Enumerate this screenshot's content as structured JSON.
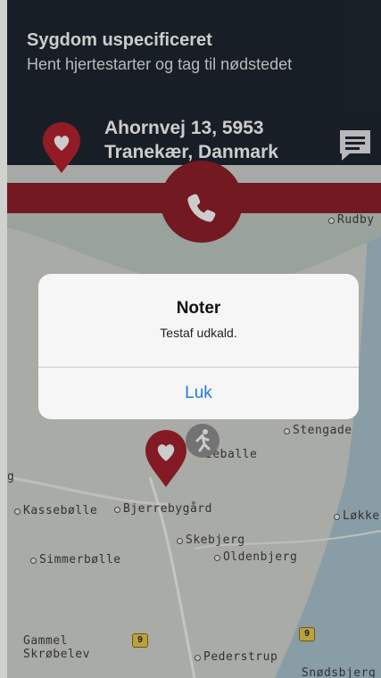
{
  "banner": {
    "title": "Sygdom uspecificeret",
    "subtitle": "Hent hjertestarter og tag til nødstedet",
    "address": "Ahornvej 13, 5953 Tranekær, Danmark",
    "icons": {
      "location": "heart-location-pin-icon",
      "chat": "chat-icon",
      "call": "phone-icon"
    }
  },
  "colors": {
    "banner": "#19212b",
    "accent_red": "#8c1a24",
    "alert_button": "#1f7ae0"
  },
  "alert": {
    "title": "Noter",
    "message": "Testaf udkald.",
    "button": "Luk"
  },
  "map": {
    "places": {
      "rudby": "Rudby",
      "stengade": "Stengade",
      "eballe": "ieballe",
      "kassebolle": "Kassebølle",
      "bjerrebygaard": "Bjerrebygård",
      "lokke": "Løkke",
      "skebjerg": "Skebjerg",
      "simmerbolle": "Simmerbølle",
      "oldenbjerg": "Oldenbjerg",
      "gammel": "Gammel",
      "skrobelev": "Skrøbelev",
      "pederstrup": "Pederstrup",
      "snodsbjerg": "Snødsbjerg",
      "route1": "9",
      "route2": "9",
      "g": "g"
    },
    "icons": {
      "pin": "heart-location-pin-icon",
      "runner": "running-person-icon"
    }
  }
}
